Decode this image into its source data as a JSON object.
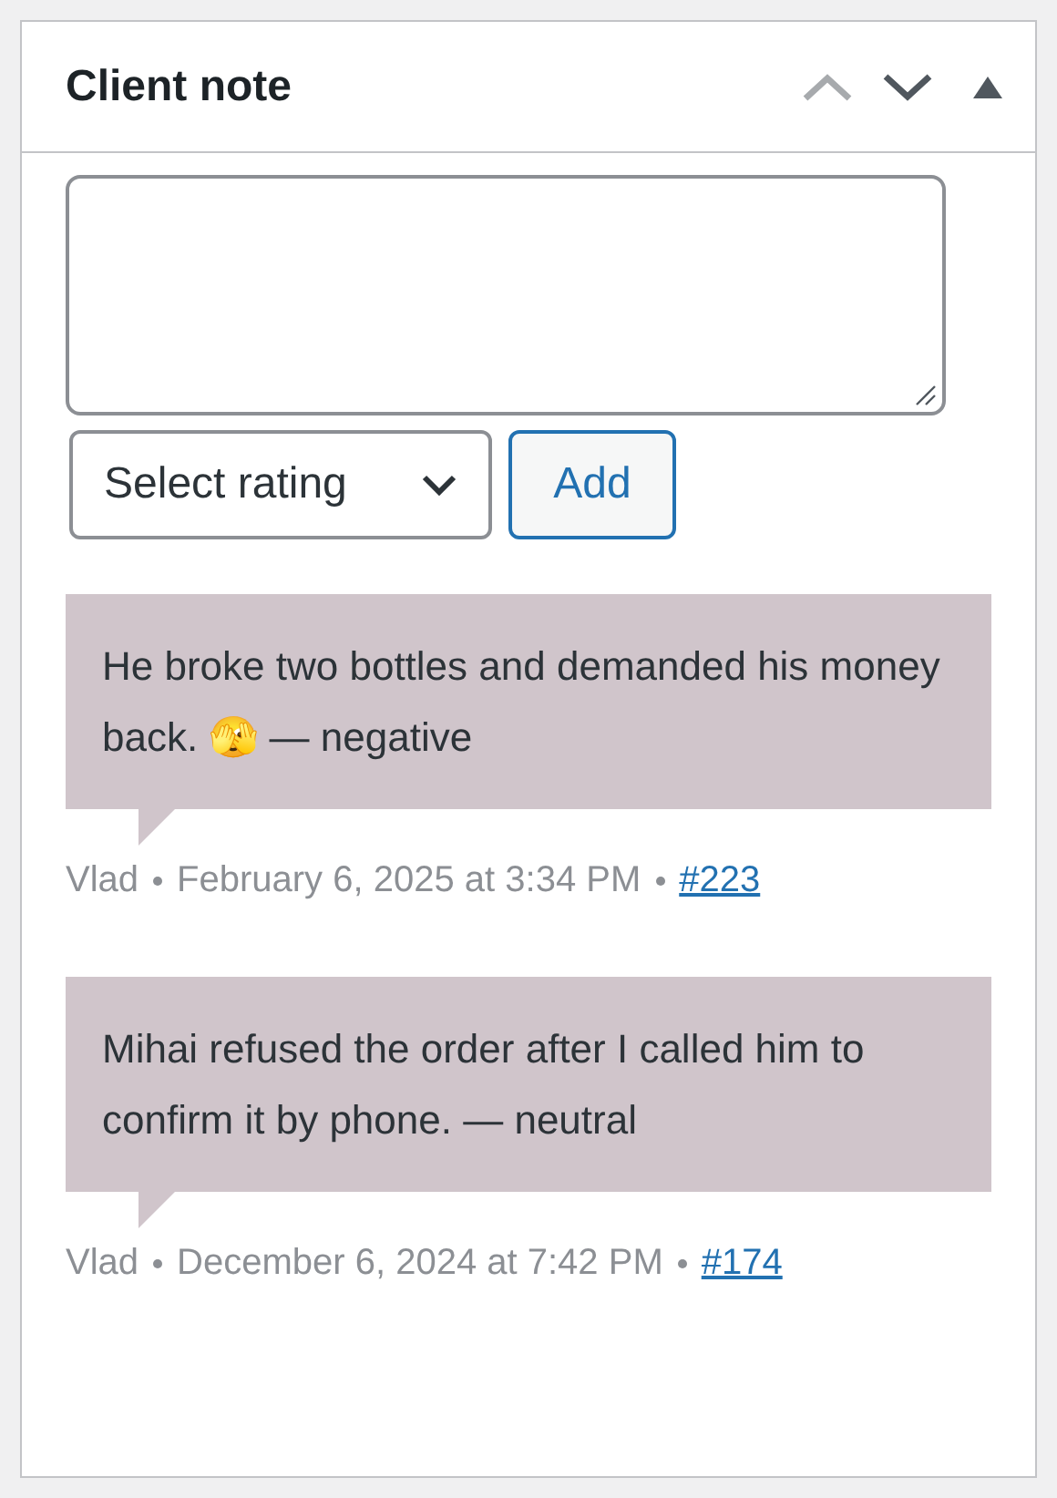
{
  "panel": {
    "title": "Client note",
    "controls": [
      {
        "kind": "up",
        "disabled": true
      },
      {
        "kind": "down",
        "disabled": false
      },
      {
        "kind": "toggle",
        "disabled": false
      }
    ]
  },
  "form": {
    "select": {
      "value": "Select rating"
    },
    "button": "Add"
  },
  "notes": [
    {
      "text": "He broke two bottles and demanded his money back. 🫣 — negative",
      "author": "Vlad",
      "date": "February 6, 2025 at 3:34 PM",
      "link": "#223"
    },
    {
      "text": "Mihai refused the order after I called him to confirm it by phone. — neutral",
      "author": "Vlad",
      "date": "December 6, 2024 at 7:42 PM",
      "link": "#174"
    }
  ]
}
